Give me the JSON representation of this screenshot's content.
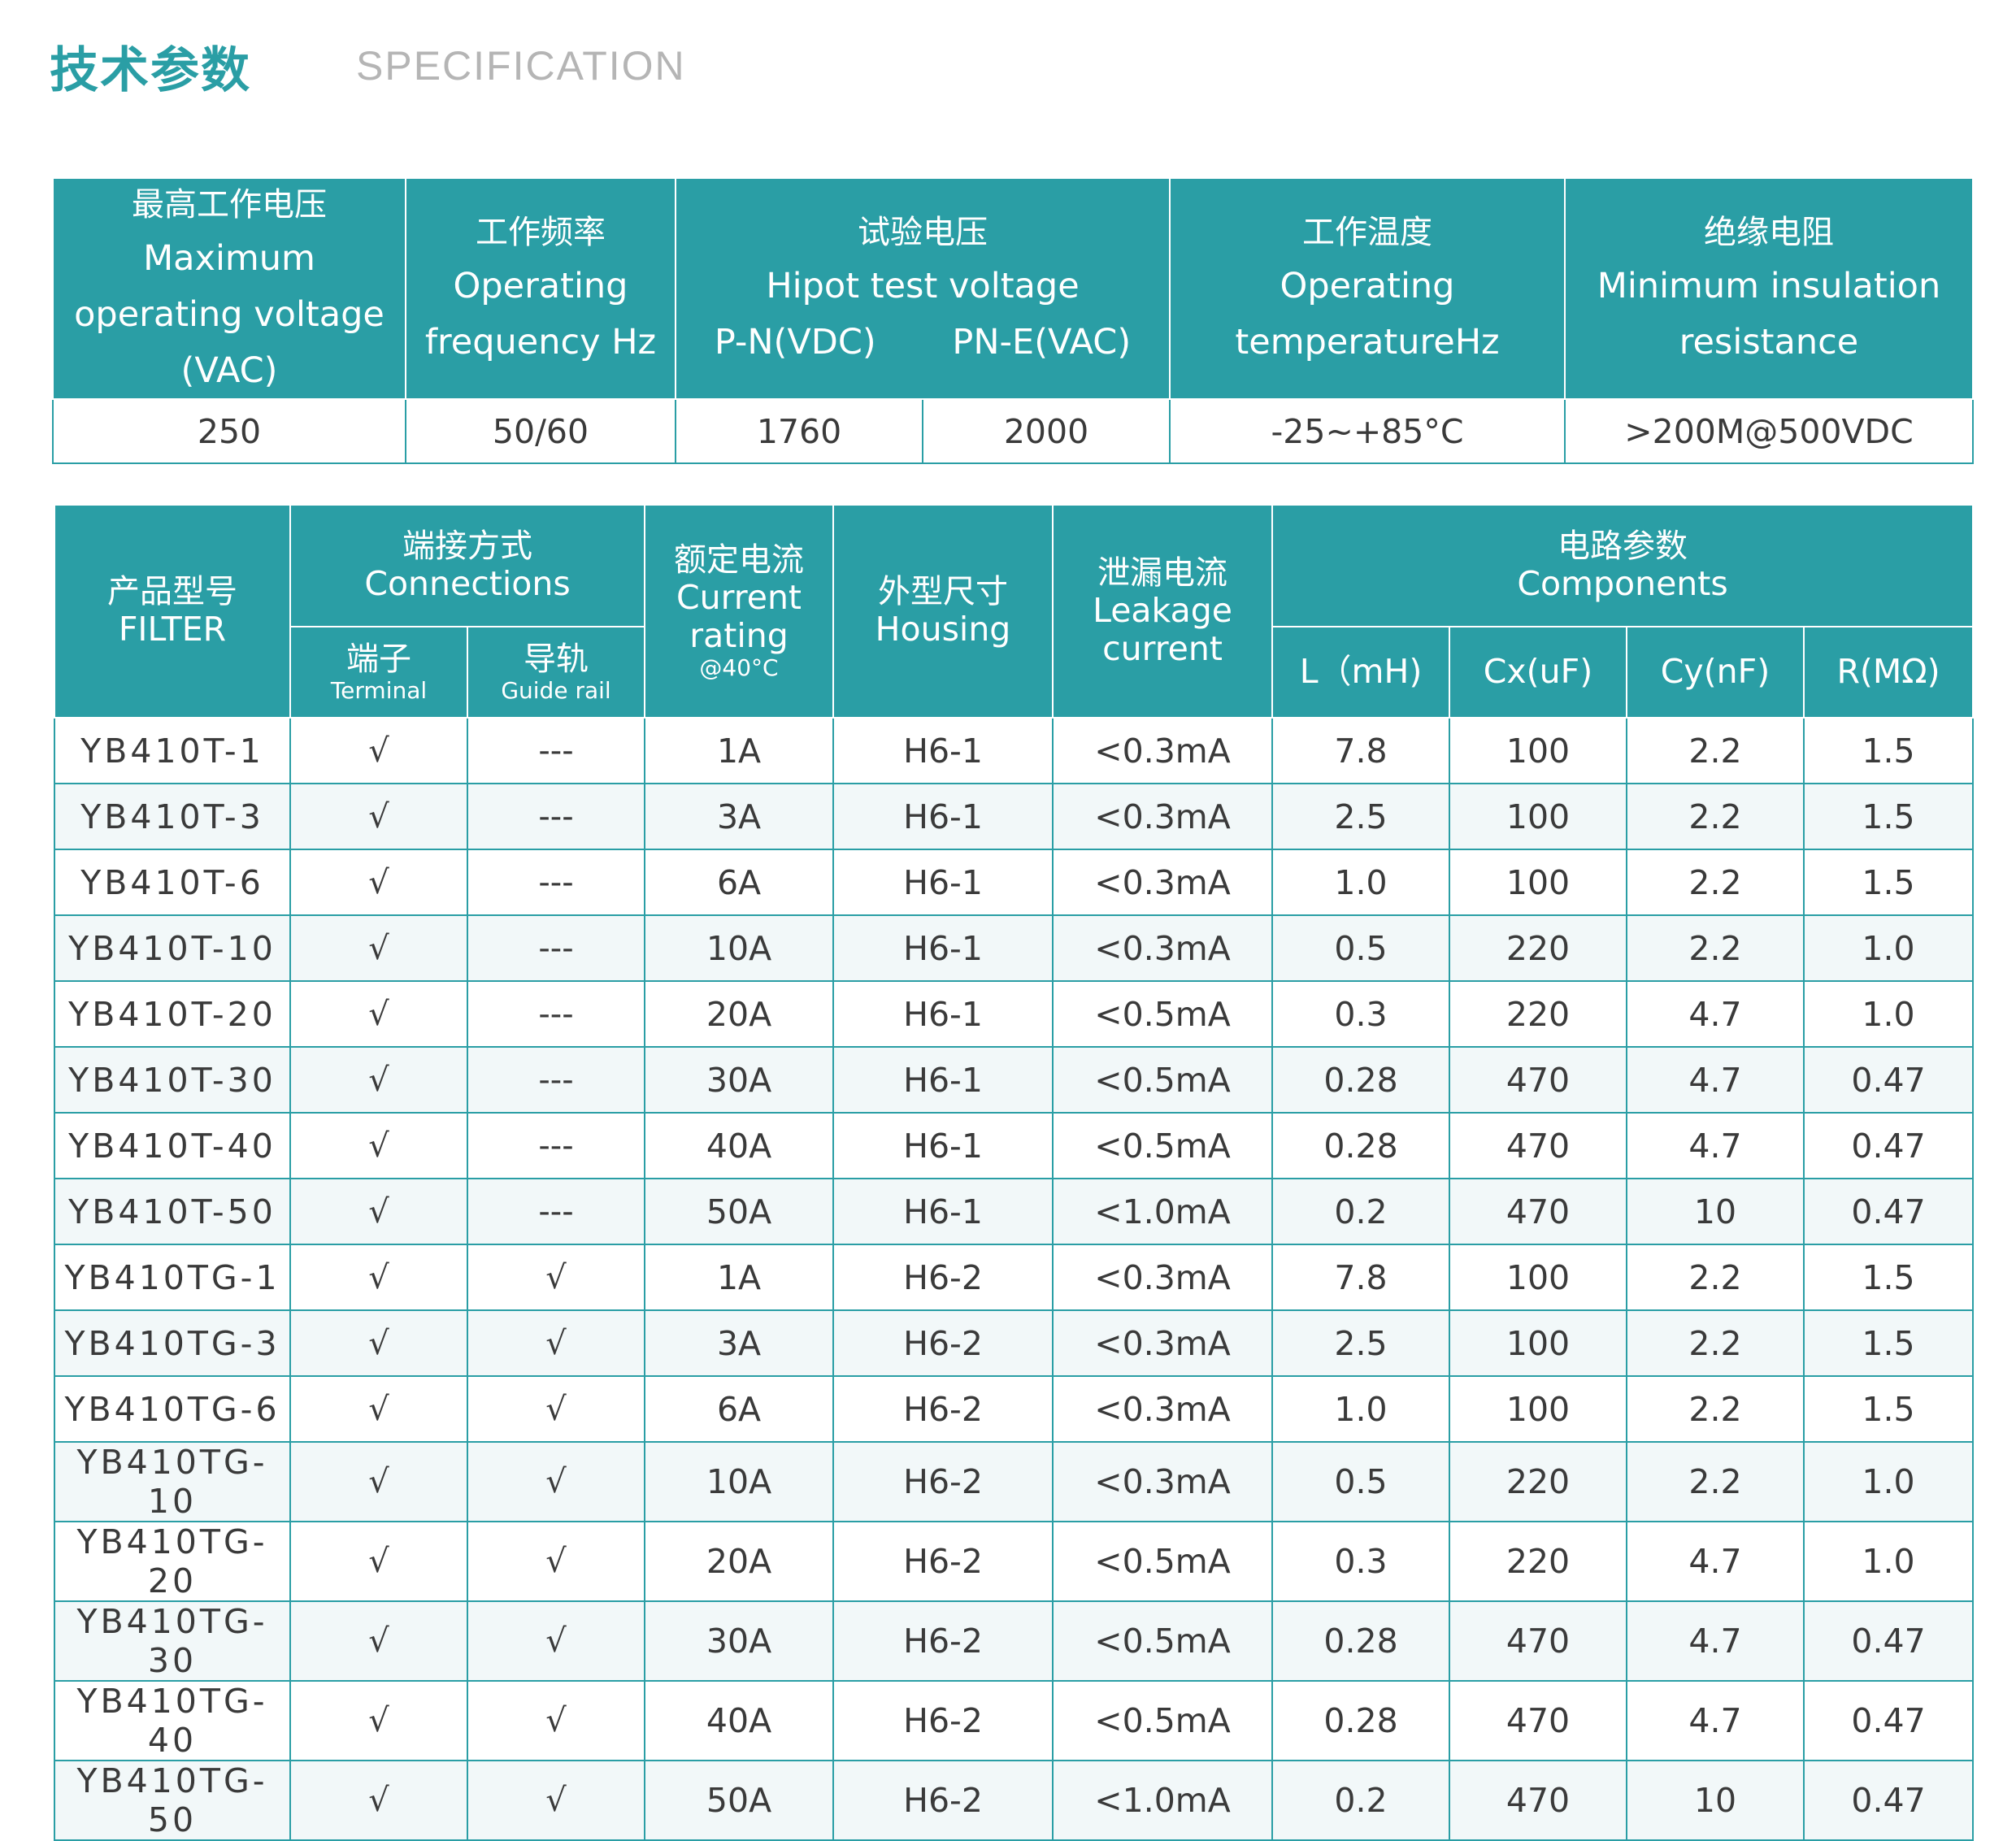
{
  "header": {
    "title_cn": "技术参数",
    "title_en": "SPECIFICATION"
  },
  "general_table": {
    "headers": [
      {
        "cn": "最高工作电压",
        "en": "Maximum operating voltage　(VAC)"
      },
      {
        "cn": "工作频率",
        "en": "Operating frequency Hz"
      },
      {
        "cn": "试验电压",
        "en": "Hipot test voltage",
        "sub": [
          "P-N(VDC)",
          "PN-E(VAC)"
        ]
      },
      {
        "cn": "工作温度",
        "en": "Operating temperatureHz"
      },
      {
        "cn": "绝缘电阻",
        "en": "Minimum insulation resistance"
      }
    ],
    "values": [
      "250",
      "50/60",
      "1760",
      "2000",
      "-25~+85°C",
      ">200M@500VDC"
    ]
  },
  "product_table": {
    "headers": {
      "filter": {
        "cn": "产品型号",
        "en": "FILTER"
      },
      "connections": {
        "cn": "端接方式",
        "en": "Connections"
      },
      "terminal": {
        "cn": "端子",
        "en": "Terminal"
      },
      "guide_rail": {
        "cn": "导轨",
        "en": "Guide rail"
      },
      "current": {
        "cn": "额定电流",
        "en": "Current rating",
        "note": "@40°C"
      },
      "housing": {
        "cn": "外型尺寸",
        "en": "Housing"
      },
      "leakage": {
        "cn": "泄漏电流",
        "en": "Leakage current"
      },
      "components": {
        "cn": "电路参数",
        "en": "Components"
      },
      "l": "L（mH)",
      "cx": "Cx(uF)",
      "cy": "Cy(nF)",
      "r": "R(MΩ)"
    },
    "rows": [
      {
        "model": "YB410T-1",
        "terminal": "√",
        "guide": "---",
        "current": "1A",
        "housing": "H6-1",
        "leakage": "<0.3mA",
        "l": "7.8",
        "cx": "100",
        "cy": "2.2",
        "r": "1.5"
      },
      {
        "model": "YB410T-3",
        "terminal": "√",
        "guide": "---",
        "current": "3A",
        "housing": "H6-1",
        "leakage": "<0.3mA",
        "l": "2.5",
        "cx": "100",
        "cy": "2.2",
        "r": "1.5"
      },
      {
        "model": "YB410T-6",
        "terminal": "√",
        "guide": "---",
        "current": "6A",
        "housing": "H6-1",
        "leakage": "<0.3mA",
        "l": "1.0",
        "cx": "100",
        "cy": "2.2",
        "r": "1.5"
      },
      {
        "model": "YB410T-10",
        "terminal": "√",
        "guide": "---",
        "current": "10A",
        "housing": "H6-1",
        "leakage": "<0.3mA",
        "l": "0.5",
        "cx": "220",
        "cy": "2.2",
        "r": "1.0"
      },
      {
        "model": "YB410T-20",
        "terminal": "√",
        "guide": "---",
        "current": "20A",
        "housing": "H6-1",
        "leakage": "<0.5mA",
        "l": "0.3",
        "cx": "220",
        "cy": "4.7",
        "r": "1.0"
      },
      {
        "model": "YB410T-30",
        "terminal": "√",
        "guide": "---",
        "current": "30A",
        "housing": "H6-1",
        "leakage": "<0.5mA",
        "l": "0.28",
        "cx": "470",
        "cy": "4.7",
        "r": "0.47"
      },
      {
        "model": "YB410T-40",
        "terminal": "√",
        "guide": "---",
        "current": "40A",
        "housing": "H6-1",
        "leakage": "<0.5mA",
        "l": "0.28",
        "cx": "470",
        "cy": "4.7",
        "r": "0.47"
      },
      {
        "model": "YB410T-50",
        "terminal": "√",
        "guide": "---",
        "current": "50A",
        "housing": "H6-1",
        "leakage": "<1.0mA",
        "l": "0.2",
        "cx": "470",
        "cy": "10",
        "r": "0.47"
      },
      {
        "model": "YB410TG-1",
        "terminal": "√",
        "guide": "√",
        "current": "1A",
        "housing": "H6-2",
        "leakage": "<0.3mA",
        "l": "7.8",
        "cx": "100",
        "cy": "2.2",
        "r": "1.5"
      },
      {
        "model": "YB410TG-3",
        "terminal": "√",
        "guide": "√",
        "current": "3A",
        "housing": "H6-2",
        "leakage": "<0.3mA",
        "l": "2.5",
        "cx": "100",
        "cy": "2.2",
        "r": "1.5"
      },
      {
        "model": "YB410TG-6",
        "terminal": "√",
        "guide": "√",
        "current": "6A",
        "housing": "H6-2",
        "leakage": "<0.3mA",
        "l": "1.0",
        "cx": "100",
        "cy": "2.2",
        "r": "1.5"
      },
      {
        "model": "YB410TG-10",
        "terminal": "√",
        "guide": "√",
        "current": "10A",
        "housing": "H6-2",
        "leakage": "<0.3mA",
        "l": "0.5",
        "cx": "220",
        "cy": "2.2",
        "r": "1.0"
      },
      {
        "model": "YB410TG-20",
        "terminal": "√",
        "guide": "√",
        "current": "20A",
        "housing": "H6-2",
        "leakage": "<0.5mA",
        "l": "0.3",
        "cx": "220",
        "cy": "4.7",
        "r": "1.0"
      },
      {
        "model": "YB410TG-30",
        "terminal": "√",
        "guide": "√",
        "current": "30A",
        "housing": "H6-2",
        "leakage": "<0.5mA",
        "l": "0.28",
        "cx": "470",
        "cy": "4.7",
        "r": "0.47"
      },
      {
        "model": "YB410TG-40",
        "terminal": "√",
        "guide": "√",
        "current": "40A",
        "housing": "H6-2",
        "leakage": "<0.5mA",
        "l": "0.28",
        "cx": "470",
        "cy": "4.7",
        "r": "0.47"
      },
      {
        "model": "YB410TG-50",
        "terminal": "√",
        "guide": "√",
        "current": "50A",
        "housing": "H6-2",
        "leakage": "<1.0mA",
        "l": "0.2",
        "cx": "470",
        "cy": "10",
        "r": "0.47"
      }
    ]
  }
}
